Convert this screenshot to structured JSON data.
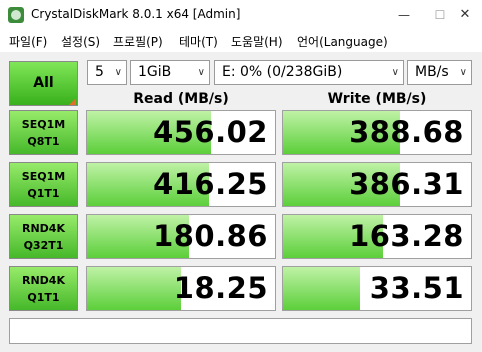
{
  "window": {
    "title": "CrystalDiskMark 8.0.1 x64 [Admin]",
    "minimize_glyph": "—",
    "maximize_glyph": "☐",
    "close_glyph": "✕",
    "icon": "app-icon"
  },
  "menu": {
    "file": "파일(F)",
    "settings": "설정(S)",
    "profile": "프로필(P)",
    "theme": "테마(T)",
    "help": "도움말(H)",
    "language": "언어(Language)"
  },
  "controls": {
    "all_label": "All",
    "count": "5",
    "size": "1GiB",
    "drive": "E: 0% (0/238GiB)",
    "unit": "MB/s",
    "arrow_glyph": "∨"
  },
  "headers": {
    "read": "Read (MB/s)",
    "write": "Write (MB/s)"
  },
  "tests": [
    {
      "line1": "SEQ1M",
      "line2": "Q8T1",
      "read": "456.02",
      "write": "388.68",
      "read_fill": 0.66,
      "write_fill": 0.62
    },
    {
      "line1": "SEQ1M",
      "line2": "Q1T1",
      "read": "416.25",
      "write": "386.31",
      "read_fill": 0.65,
      "write_fill": 0.62
    },
    {
      "line1": "RND4K",
      "line2": "Q32T1",
      "read": "180.86",
      "write": "163.28",
      "read_fill": 0.54,
      "write_fill": 0.53
    },
    {
      "line1": "RND4K",
      "line2": "Q1T1",
      "read": "18.25",
      "write": "33.51",
      "read_fill": 0.5,
      "write_fill": 0.41
    }
  ],
  "colors": {
    "accent_green": "#46b82a",
    "bar_green": "#5ccf3a",
    "corner_orange": "#e0702a"
  },
  "comment": ""
}
